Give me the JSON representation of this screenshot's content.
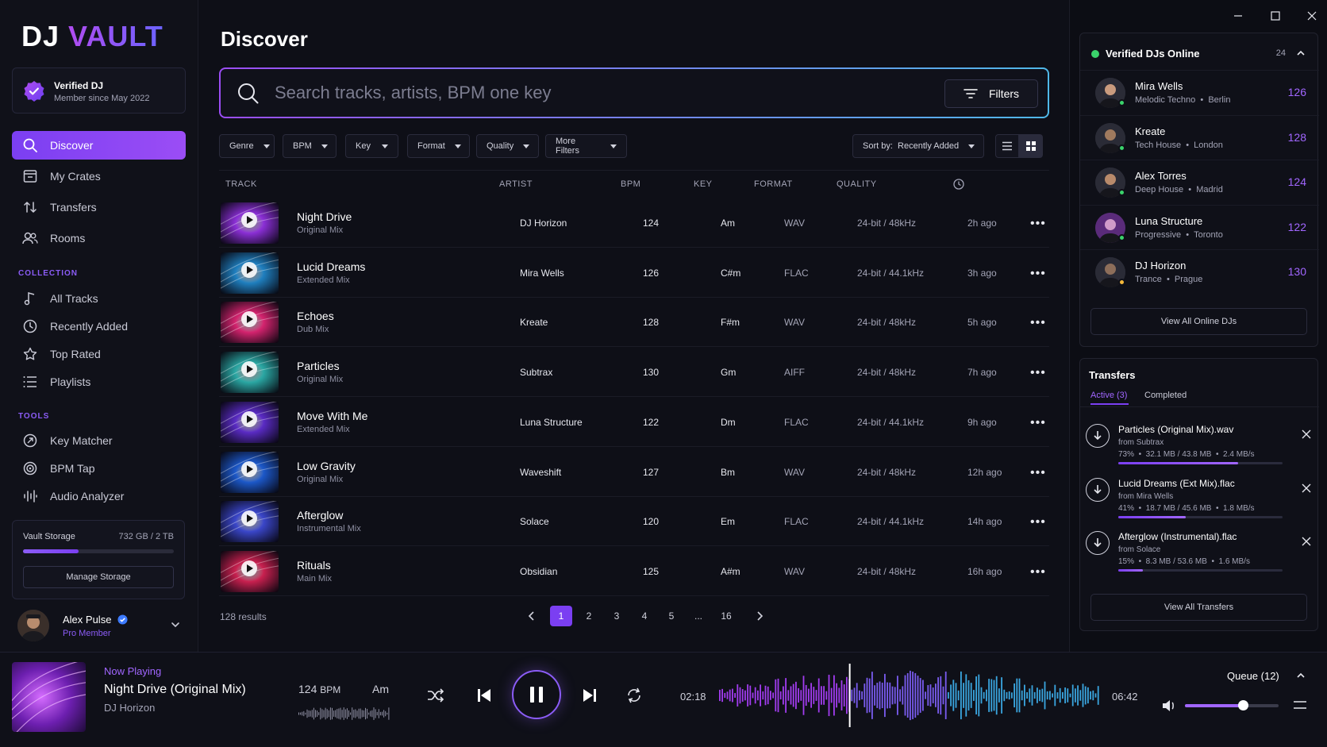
{
  "app": {
    "logo_a": "DJ",
    "logo_b": "VAULT"
  },
  "verified": {
    "title": "Verified DJ",
    "subtitle": "Member since May 2022"
  },
  "nav": [
    {
      "label": "Discover",
      "icon": "search-icon"
    },
    {
      "label": "My Crates",
      "icon": "crate-icon"
    },
    {
      "label": "Transfers",
      "icon": "transfer-icon"
    },
    {
      "label": "Rooms",
      "icon": "users-icon"
    }
  ],
  "collection": {
    "label": "COLLECTION",
    "items": [
      {
        "label": "All Tracks",
        "icon": "music-note-icon"
      },
      {
        "label": "Recently Added",
        "icon": "clock-icon"
      },
      {
        "label": "Top Rated",
        "icon": "star-icon"
      },
      {
        "label": "Playlists",
        "icon": "list-icon"
      }
    ]
  },
  "tools": {
    "label": "TOOLS",
    "items": [
      {
        "label": "Key Matcher",
        "icon": "key-matcher-icon"
      },
      {
        "label": "BPM Tap",
        "icon": "target-icon"
      },
      {
        "label": "Audio Analyzer",
        "icon": "waveform-icon"
      }
    ]
  },
  "storage": {
    "label": "Vault Storage",
    "value": "732 GB / 2 TB",
    "fraction": 0.366,
    "button": "Manage Storage"
  },
  "user": {
    "name": "Alex Pulse",
    "tier": "Pro Member"
  },
  "main": {
    "title": "Discover",
    "search_placeholder": "Search tracks, artists, BPM one key",
    "filters_label": "Filters",
    "chips": [
      "Genre",
      "BPM",
      "Key",
      "Format",
      "Quality",
      "More Filters"
    ],
    "sort_label": "Sort by:  Recently Added",
    "columns": [
      "TRACK",
      "ARTIST",
      "BPM",
      "KEY",
      "FORMAT",
      "QUALITY"
    ],
    "tracks": [
      {
        "title": "Night Drive",
        "mix": "Original Mix",
        "artist": "DJ Horizon",
        "bpm": "124",
        "key": "Am",
        "format": "WAV",
        "quality": "24-bit / 48kHz",
        "time": "2h ago",
        "art": "#8b2fd6"
      },
      {
        "title": "Lucid Dreams",
        "mix": "Extended Mix",
        "artist": "Mira Wells",
        "bpm": "126",
        "key": "C#m",
        "format": "FLAC",
        "quality": "24-bit / 44.1kHz",
        "time": "3h ago",
        "art": "#1f7fbf"
      },
      {
        "title": "Echoes",
        "mix": "Dub Mix",
        "artist": "Kreate",
        "bpm": "128",
        "key": "F#m",
        "format": "WAV",
        "quality": "24-bit / 48kHz",
        "time": "5h ago",
        "art": "#d4236e"
      },
      {
        "title": "Particles",
        "mix": "Original Mix",
        "artist": "Subtrax",
        "bpm": "130",
        "key": "Gm",
        "format": "AIFF",
        "quality": "24-bit / 48kHz",
        "time": "7h ago",
        "art": "#2aa7a3"
      },
      {
        "title": "Move With Me",
        "mix": "Extended Mix",
        "artist": "Luna Structure",
        "bpm": "122",
        "key": "Dm",
        "format": "FLAC",
        "quality": "24-bit / 44.1kHz",
        "time": "9h ago",
        "art": "#5a2bc4"
      },
      {
        "title": "Low Gravity",
        "mix": "Original Mix",
        "artist": "Waveshift",
        "bpm": "127",
        "key": "Bm",
        "format": "WAV",
        "quality": "24-bit / 48kHz",
        "time": "12h ago",
        "art": "#1c58c9"
      },
      {
        "title": "Afterglow",
        "mix": "Instrumental Mix",
        "artist": "Solace",
        "bpm": "120",
        "key": "Em",
        "format": "FLAC",
        "quality": "24-bit / 44.1kHz",
        "time": "14h ago",
        "art": "#3a46c9"
      },
      {
        "title": "Rituals",
        "mix": "Main Mix",
        "artist": "Obsidian",
        "bpm": "125",
        "key": "A#m",
        "format": "WAV",
        "quality": "24-bit / 48kHz",
        "time": "16h ago",
        "art": "#c8204f"
      }
    ],
    "results": "128 results",
    "pages": [
      "1",
      "2",
      "3",
      "4",
      "5",
      "...",
      "16"
    ]
  },
  "online": {
    "title": "Verified DJs Online",
    "count": "24",
    "djs": [
      {
        "name": "Mira Wells",
        "genre": "Melodic Techno",
        "city": "Berlin",
        "bpm": "126",
        "status": "#3ad36b"
      },
      {
        "name": "Kreate",
        "genre": "Tech House",
        "city": "London",
        "bpm": "128",
        "status": "#3ad36b"
      },
      {
        "name": "Alex Torres",
        "genre": "Deep House",
        "city": "Madrid",
        "bpm": "124",
        "status": "#3ad36b"
      },
      {
        "name": "Luna Structure",
        "genre": "Progressive",
        "city": "Toronto",
        "bpm": "122",
        "status": "#3ad36b"
      },
      {
        "name": "DJ Horizon",
        "genre": "Trance",
        "city": "Prague",
        "bpm": "130",
        "status": "#f5b83a"
      }
    ],
    "button": "View All Online DJs"
  },
  "transfers": {
    "title": "Transfers",
    "tab_active": "Active (3)",
    "tab_completed": "Completed",
    "items": [
      {
        "name": "Particles (Original Mix).wav",
        "from": "from Subtrax",
        "stats": "73%  •  32.1 MB / 43.8 MB  •  2.4 MB/s",
        "progress": 0.73
      },
      {
        "name": "Lucid Dreams (Ext Mix).flac",
        "from": "from Mira Wells",
        "stats": "41%  •  18.7 MB / 45.6 MB  •  1.8 MB/s",
        "progress": 0.41
      },
      {
        "name": "Afterglow (Instrumental).flac",
        "from": "from Solace",
        "stats": "15%  •  8.3 MB / 53.6 MB  •  1.6 MB/s",
        "progress": 0.15
      }
    ],
    "button": "View All Transfers"
  },
  "player": {
    "label": "Now Playing",
    "title": "Night Drive (Original Mix)",
    "artist": "DJ Horizon",
    "bpm": "124",
    "bpm_unit": "BPM",
    "key": "Am",
    "elapsed": "02:18",
    "duration": "06:42",
    "progress": 0.343,
    "queue": "Queue (12)",
    "volume": 0.62
  },
  "colors": {
    "accent": "#7b3ff2",
    "accent_light": "#a166ff",
    "online": "#3ad36b"
  }
}
